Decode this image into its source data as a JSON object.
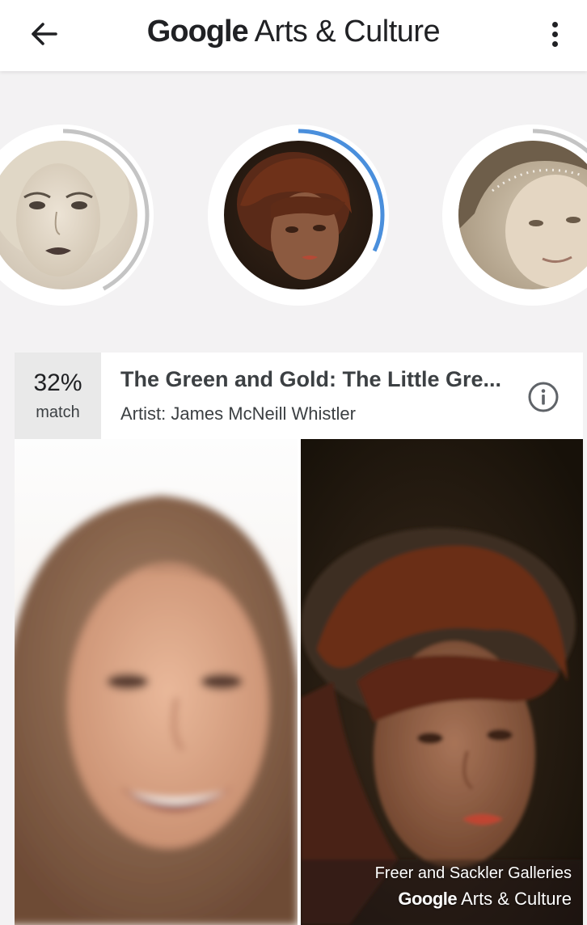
{
  "app_bar": {
    "brand": "Google",
    "product": "Arts & Culture",
    "back_icon": "arrow-left-icon",
    "menu_icon": "more-vert-icon"
  },
  "carousel": {
    "items": [
      {
        "name": "left-match",
        "progress": 0.42,
        "ring_color": "#c4c4c4"
      },
      {
        "name": "selected-match",
        "progress": 0.32,
        "ring_color": "#4a8fdc"
      },
      {
        "name": "right-match",
        "progress": 0.3,
        "ring_color": "#c4c4c4"
      }
    ]
  },
  "result": {
    "match_percent": "32%",
    "match_label": "match",
    "title": "The Green and Gold: The Little Gre...",
    "artist": "Artist: James McNeill Whistler",
    "info_icon": "info-icon",
    "credit_gallery": "Freer and Sackler Galleries",
    "credit_brand": "Google",
    "credit_product": "Arts & Culture"
  },
  "colors": {
    "selected_ring": "#4a8fdc",
    "unselected_ring": "#c4c4c4",
    "badge_background": "#e9e9e9"
  }
}
